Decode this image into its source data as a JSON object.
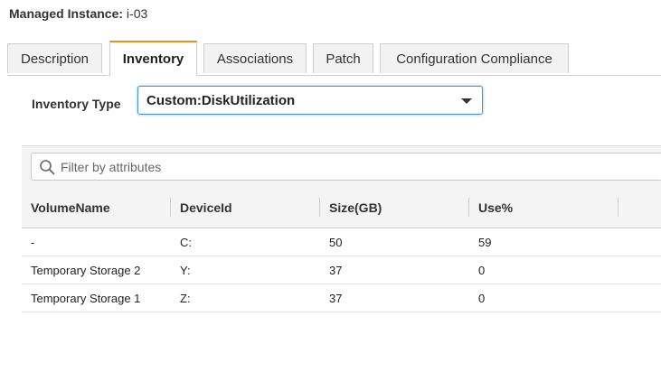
{
  "header": {
    "label": "Managed Instance:",
    "instance_id": "i-03"
  },
  "tabs": [
    {
      "label": "Description",
      "active": false
    },
    {
      "label": "Inventory",
      "active": true
    },
    {
      "label": "Associations",
      "active": false
    },
    {
      "label": "Patch",
      "active": false
    },
    {
      "label": "Configuration Compliance",
      "active": false
    }
  ],
  "inventory_type": {
    "label": "Inventory Type",
    "selected": "Custom:DiskUtilization"
  },
  "filter": {
    "placeholder": "Filter by attributes"
  },
  "table": {
    "columns": [
      "VolumeName",
      "DeviceId",
      "Size(GB)",
      "Use%",
      ""
    ],
    "rows": [
      [
        "-",
        "C:",
        "50",
        "59"
      ],
      [
        "Temporary Storage 2",
        "Y:",
        "37",
        "0"
      ],
      [
        "Temporary Storage 1",
        "Z:",
        "37",
        "0"
      ]
    ]
  },
  "colors": {
    "active_tab_accent": "#ec8d1c",
    "select_focus_border": "#4a90d9"
  }
}
